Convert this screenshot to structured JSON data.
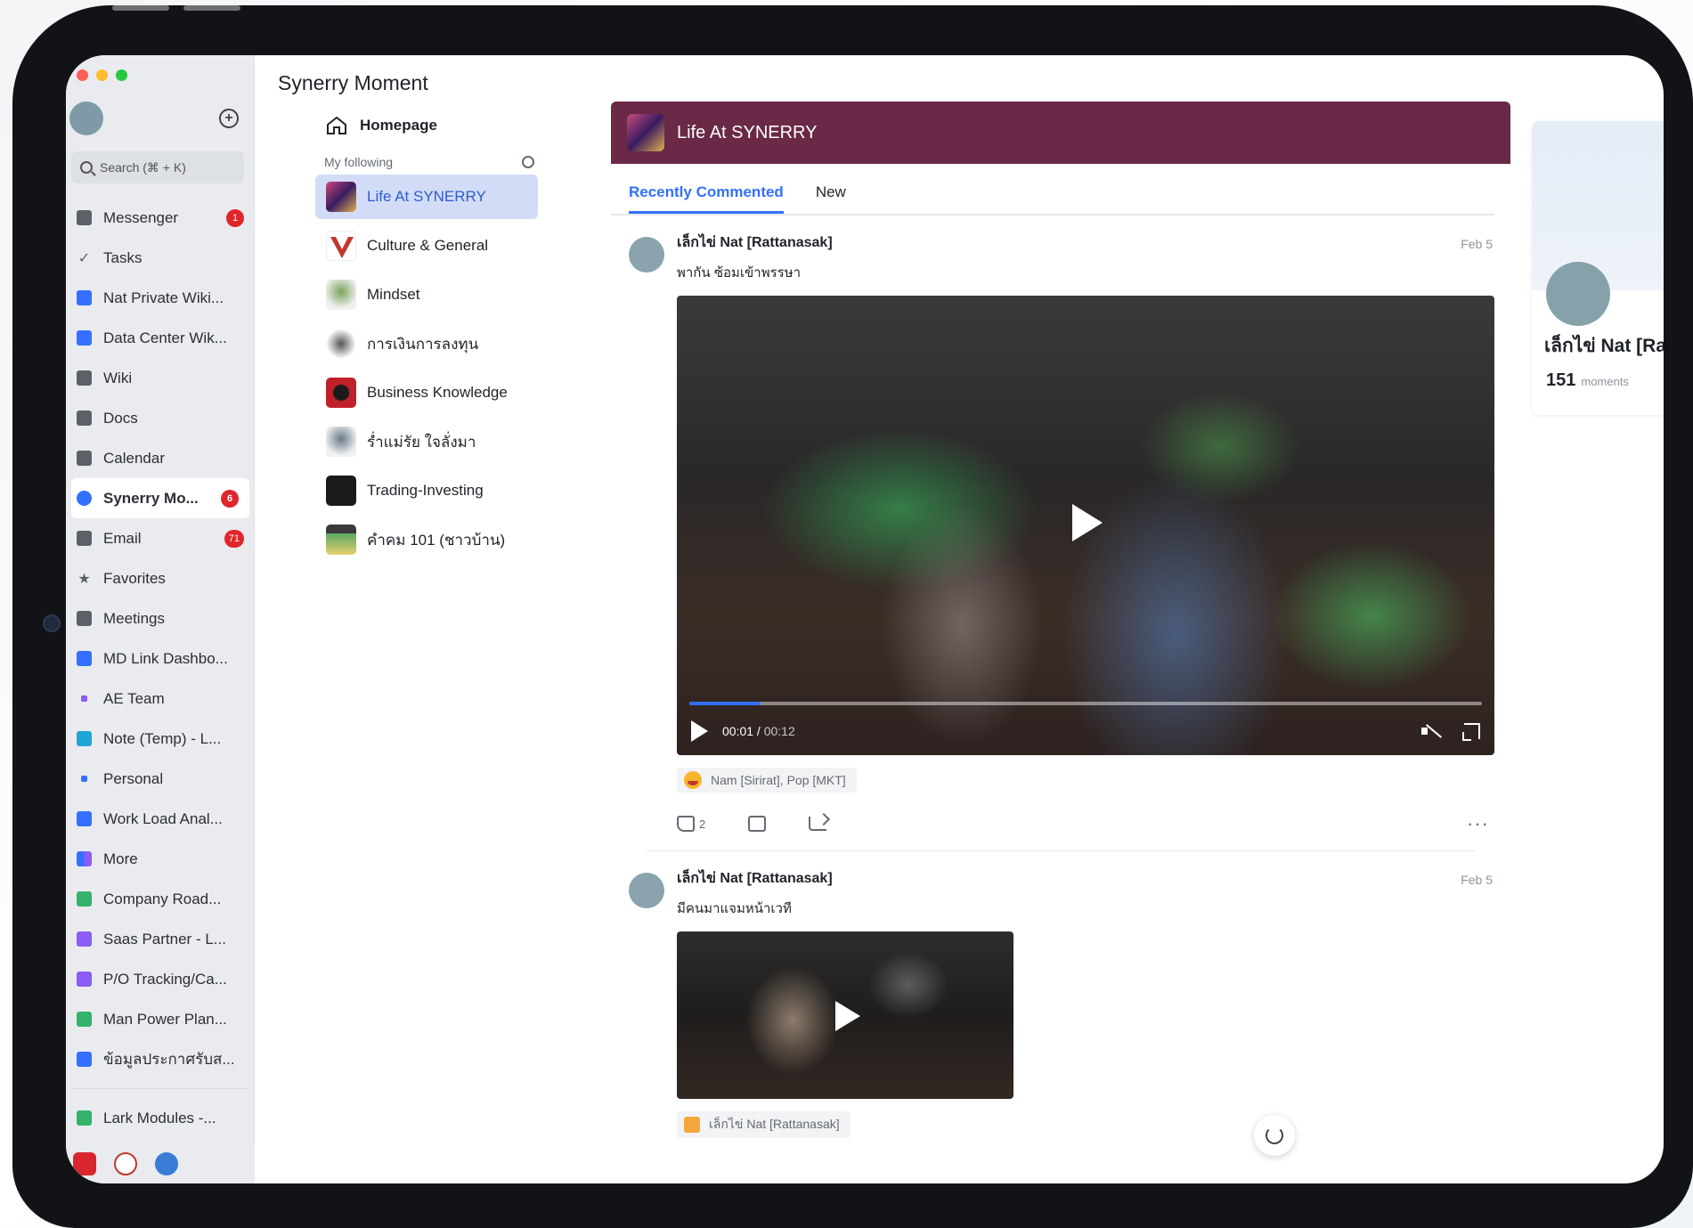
{
  "app": {
    "title": "Synerry Moment"
  },
  "lark": {
    "search_placeholder": "Search (⌘ + K)",
    "items": [
      {
        "label": "Messenger",
        "icon": "chat-bubbles-icon",
        "badge": "1"
      },
      {
        "label": "Tasks",
        "icon": "checkmark-icon",
        "badge": ""
      },
      {
        "label": "Nat Private Wiki...",
        "icon": "doc-blue-icon",
        "badge": ""
      },
      {
        "label": "Data Center Wik...",
        "icon": "doc-blue-icon",
        "badge": ""
      },
      {
        "label": "Wiki",
        "icon": "wiki-icon",
        "badge": ""
      },
      {
        "label": "Docs",
        "icon": "docs-icon",
        "badge": ""
      },
      {
        "label": "Calendar",
        "icon": "calendar-icon",
        "badge": ""
      },
      {
        "label": "Synerry Mo...",
        "icon": "moments-icon",
        "badge": "6"
      },
      {
        "label": "Email",
        "icon": "email-icon",
        "badge": "71"
      },
      {
        "label": "Favorites",
        "icon": "star-icon",
        "badge": ""
      },
      {
        "label": "Meetings",
        "icon": "video-camera-icon",
        "badge": ""
      },
      {
        "label": "MD Link Dashbo...",
        "icon": "doc-blue-icon",
        "badge": ""
      },
      {
        "label": "AE Team",
        "icon": "dot-purple-icon",
        "badge": ""
      },
      {
        "label": "Note (Temp) - L...",
        "icon": "doc-teal-icon",
        "badge": ""
      },
      {
        "label": "Personal",
        "icon": "dot-blue-icon",
        "badge": ""
      },
      {
        "label": "Work Load Anal...",
        "icon": "doc-blue-icon",
        "badge": ""
      },
      {
        "label": "More",
        "icon": "grid-more-icon",
        "badge": ""
      },
      {
        "label": "Company Road...",
        "icon": "sheet-green-icon",
        "badge": ""
      },
      {
        "label": "Saas Partner - L...",
        "icon": "sheet-purple-icon",
        "badge": ""
      },
      {
        "label": "P/O Tracking/Ca...",
        "icon": "sheet-purple-icon",
        "badge": ""
      },
      {
        "label": "Man Power Plan...",
        "icon": "sheet-green-icon",
        "badge": ""
      },
      {
        "label": "ข้อมูลประกาศรับส...",
        "icon": "doc-blue-icon",
        "badge": ""
      }
    ],
    "bottom_item": {
      "label": "Lark Modules -...",
      "icon": "sheet-green-icon"
    },
    "colors": {
      "accent": "#3370ff",
      "badge": "#e0262b"
    }
  },
  "nav": {
    "home": "Homepage",
    "following_label": "My following",
    "items": [
      {
        "label": "Life At SYNERRY",
        "active": true,
        "thumb_color": "#7a2a55"
      },
      {
        "label": "Culture & General",
        "active": false,
        "thumb_color": "#c0392b"
      },
      {
        "label": "Mindset",
        "active": false,
        "thumb_color": "#7aa35a"
      },
      {
        "label": "การเงินการลงทุน",
        "active": false,
        "thumb_color": "#555555"
      },
      {
        "label": "Business Knowledge",
        "active": false,
        "thumb_color": "#c0202a"
      },
      {
        "label": "ร่ำแม่รัย ใจลั่งมา",
        "active": false,
        "thumb_color": "#6a7a8a"
      },
      {
        "label": "Trading-Investing",
        "active": false,
        "thumb_color": "#1a1a1a"
      },
      {
        "label": "คำคม 101 (ชาวบ้าน)",
        "active": false,
        "thumb_color": "#5aa860"
      }
    ]
  },
  "feed": {
    "channel_title": "Life At SYNERRY",
    "banner_color": "#6a2946",
    "tabs": [
      {
        "label": "Recently Commented",
        "active": true
      },
      {
        "label": "New",
        "active": false
      }
    ],
    "posts": [
      {
        "author": "เล็กไข่ Nat [Rattanasak]",
        "date": "Feb 5",
        "text": "พากัน ซ้อมเข้าพรรษา",
        "video": {
          "current": "00:01",
          "total": "00:12",
          "progress": 0.09
        },
        "reactions": "Nam [Sirirat], Pop [MKT]",
        "likes": "2"
      },
      {
        "author": "เล็กไข่ Nat [Rattanasak]",
        "date": "Feb 5",
        "text": "มีคนมาแจมหน้าเวที",
        "reactions": "เล็กไข่ Nat [Rattanasak]"
      }
    ]
  },
  "profile": {
    "name": "เล็กไข่ Nat [Ra",
    "moments_count": "151",
    "moments_label": "moments"
  }
}
